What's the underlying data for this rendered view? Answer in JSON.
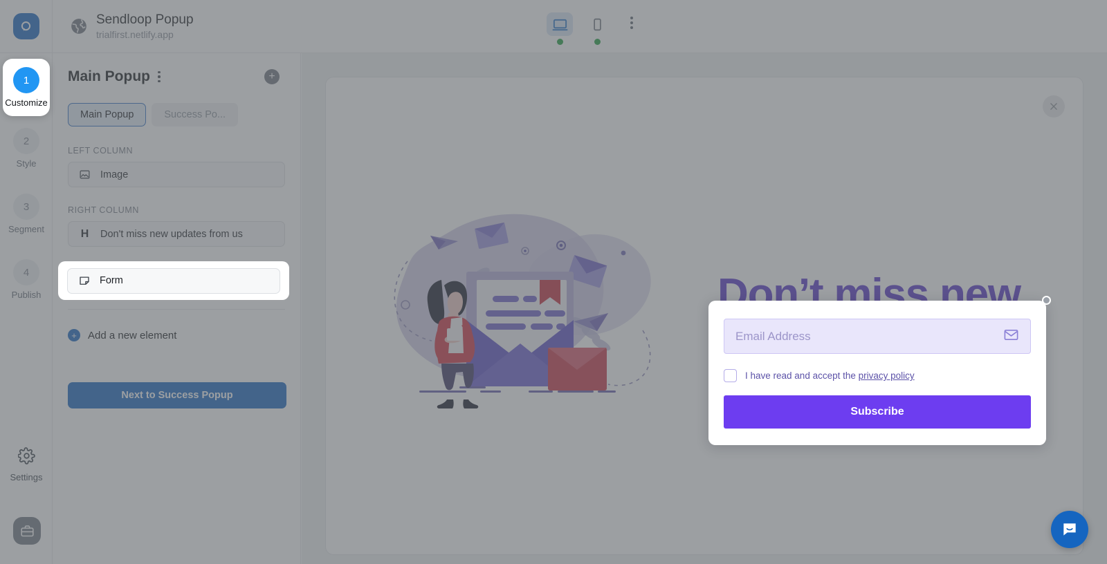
{
  "header": {
    "logo_icon": "sendloop-logo-icon",
    "globe_icon": "globe-icon",
    "site_title": "Sendloop Popup",
    "site_url": "trialfirst.netlify.app",
    "devices": [
      {
        "name": "desktop",
        "icon": "desktop-icon",
        "active": true,
        "status_dot": "#1f9d3d"
      },
      {
        "name": "mobile",
        "icon": "mobile-icon",
        "active": false,
        "status_dot": "#1f9d3d"
      }
    ],
    "more_menu_icon": "kebab-menu-icon"
  },
  "rail": {
    "steps": [
      {
        "number": "1",
        "label": "Customize",
        "active": true
      },
      {
        "number": "2",
        "label": "Style",
        "active": false
      },
      {
        "number": "3",
        "label": "Segment",
        "active": false
      },
      {
        "number": "4",
        "label": "Publish",
        "active": false
      }
    ],
    "settings": {
      "label": "Settings",
      "icon": "gear-icon"
    },
    "briefcase": {
      "icon": "briefcase-icon"
    }
  },
  "panel": {
    "title": "Main Popup",
    "options_icon": "kebab-menu-icon",
    "add_icon": "plus-circle-icon",
    "tabs": [
      {
        "label": "Main Popup",
        "active": true
      },
      {
        "label": "Success Po...",
        "active": false
      }
    ],
    "left_column": {
      "label": "LEFT COLUMN",
      "elements": [
        {
          "icon": "image-icon",
          "label": "Image"
        }
      ]
    },
    "right_column": {
      "label": "RIGHT COLUMN",
      "elements": [
        {
          "icon": "heading-icon",
          "glyph": "H",
          "label": "Don't miss new updates from us"
        },
        {
          "icon": "form-icon",
          "label": "Form",
          "highlighted": true
        }
      ]
    },
    "add_element": {
      "label": "Add a new element",
      "icon": "plus-circle-icon"
    },
    "next_button": "Next to Success Popup"
  },
  "preview": {
    "close_icon": "close-icon",
    "popup": {
      "headline": "Don’t miss new updates from us",
      "headline_color": "#5534c9",
      "illustration": "email-newsletter-illustration",
      "form": {
        "email_placeholder": "Email Address",
        "email_value": "",
        "email_icon": "envelope-icon",
        "checkbox_checked": false,
        "consent_prefix": "I have read and accept the ",
        "consent_link": "privacy policy",
        "submit_label": "Subscribe",
        "submit_color": "#6d3df0",
        "field_bg": "#e9e6fb"
      }
    }
  },
  "chat": {
    "icon": "chat-bubble-icon",
    "color": "#1565c0"
  }
}
